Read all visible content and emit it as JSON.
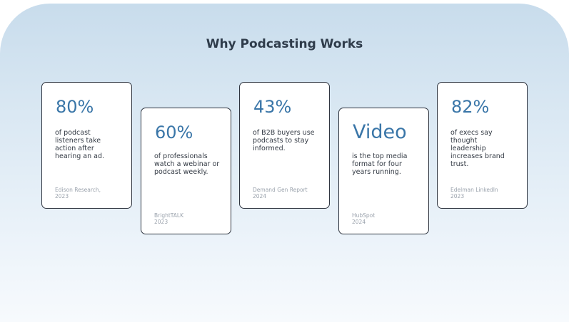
{
  "title": "Why Podcasting Works",
  "cards": [
    {
      "stat": "80%",
      "description": "of podcast listeners take action after hearing an ad.",
      "source": "Edison Research,",
      "year": "2023"
    },
    {
      "stat": "60%",
      "description": "of professionals watch a webinar or podcast weekly.",
      "source": "BrightTALK",
      "year": "2023"
    },
    {
      "stat": "43%",
      "description": "of B2B buyers use podcasts to stay informed.",
      "source": "Demand Gen Report",
      "year": "2024"
    },
    {
      "stat": "Video",
      "description": "is the top media format for four years running.",
      "source": "HubSpot",
      "year": "2024"
    },
    {
      "stat": "82%",
      "description": "of execs say thought leadership increases brand trust.",
      "source": "Edelman LinkedIn",
      "year": "2023"
    }
  ]
}
